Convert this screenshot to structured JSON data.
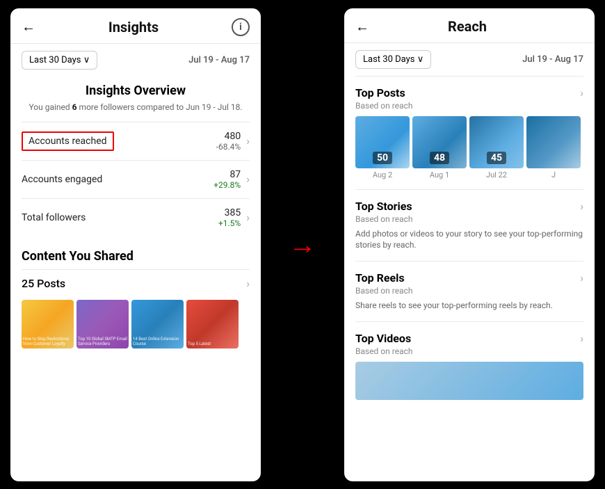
{
  "left_panel": {
    "back_label": "←",
    "title": "Insights",
    "info_icon": "i",
    "date_dropdown": "Last 30 Days ∨",
    "date_range": "Jul 19 - Aug 17",
    "overview_title": "Insights Overview",
    "followers_gained_text": "You gained ",
    "followers_gained_number": "6",
    "followers_gained_suffix": " more followers compared to Jun 19 - Jul 18.",
    "stats": [
      {
        "label": "Accounts reached",
        "number": "480",
        "change": "-68.4%",
        "change_type": "negative",
        "highlighted": true
      },
      {
        "label": "Accounts engaged",
        "number": "87",
        "change": "+29.8%",
        "change_type": "positive",
        "highlighted": false
      },
      {
        "label": "Total followers",
        "number": "385",
        "change": "+1.5%",
        "change_type": "positive",
        "highlighted": false
      }
    ],
    "content_section_title": "Content You Shared",
    "posts_label": "25 Posts"
  },
  "right_panel": {
    "back_label": "←",
    "title": "Reach",
    "date_dropdown": "Last 30 Days ∨",
    "date_range": "Jul 19 - Aug 17",
    "sections": [
      {
        "title": "Top Posts",
        "subtitle": "Based on reach",
        "type": "posts",
        "posts": [
          {
            "count": "50",
            "date": "Aug 2"
          },
          {
            "count": "48",
            "date": "Aug 1"
          },
          {
            "count": "45",
            "date": "Jul 22"
          },
          {
            "count": "",
            "date": "J"
          }
        ]
      },
      {
        "title": "Top Stories",
        "subtitle": "Based on reach",
        "type": "text",
        "desc": "Add photos or videos to your story to see your top-performing stories by reach."
      },
      {
        "title": "Top Reels",
        "subtitle": "Based on reach",
        "type": "text",
        "desc": "Share reels to see your top-performing reels by reach."
      },
      {
        "title": "Top Videos",
        "subtitle": "Based on reach",
        "type": "video",
        "desc": ""
      }
    ]
  },
  "arrow": "→"
}
